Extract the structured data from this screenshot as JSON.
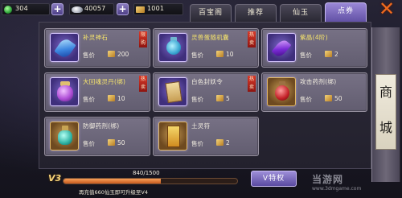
{
  "currency": [
    {
      "icon": "jade-icon",
      "value": "304"
    },
    {
      "icon": "silver-icon",
      "value": "40057"
    },
    {
      "icon": "ticket-icon",
      "value": "1001"
    }
  ],
  "tabs": [
    {
      "label": "百宝阁",
      "active": false
    },
    {
      "label": "推荐",
      "active": false
    },
    {
      "label": "仙玉",
      "active": false
    },
    {
      "label": "点券",
      "active": true
    }
  ],
  "side_banner": {
    "label": "商城"
  },
  "items": [
    {
      "name": "补灵神石",
      "price_label": "售价",
      "price": "200",
      "badge": "限购"
    },
    {
      "name": "灵兽蛋随机囊",
      "price_label": "售价",
      "price": "10",
      "badge": "热卖"
    },
    {
      "name": "紫晶(4阶)",
      "price_label": "售价",
      "price": "2",
      "badge": ""
    },
    {
      "name": "大回魂灵丹(绑)",
      "price_label": "售价",
      "price": "10",
      "badge": "热卖"
    },
    {
      "name": "白色封妖令",
      "price_label": "售价",
      "price": "5",
      "badge": "热卖"
    },
    {
      "name": "攻击药剂(绑)",
      "price_label": "售价",
      "price": "50",
      "badge": ""
    },
    {
      "name": "防御药剂(绑)",
      "price_label": "售价",
      "price": "50",
      "badge": ""
    },
    {
      "name": "土灵符",
      "price_label": "售价",
      "price": "2",
      "badge": ""
    }
  ],
  "vip": {
    "level_label": "V3",
    "progress_text": "840/1500",
    "progress_fraction": 0.56,
    "note": "再充值660仙玉即可升级至V4",
    "privilege_button": "V特权"
  },
  "watermark": {
    "text": "当游网",
    "sub": "www.3dmgame.com"
  }
}
